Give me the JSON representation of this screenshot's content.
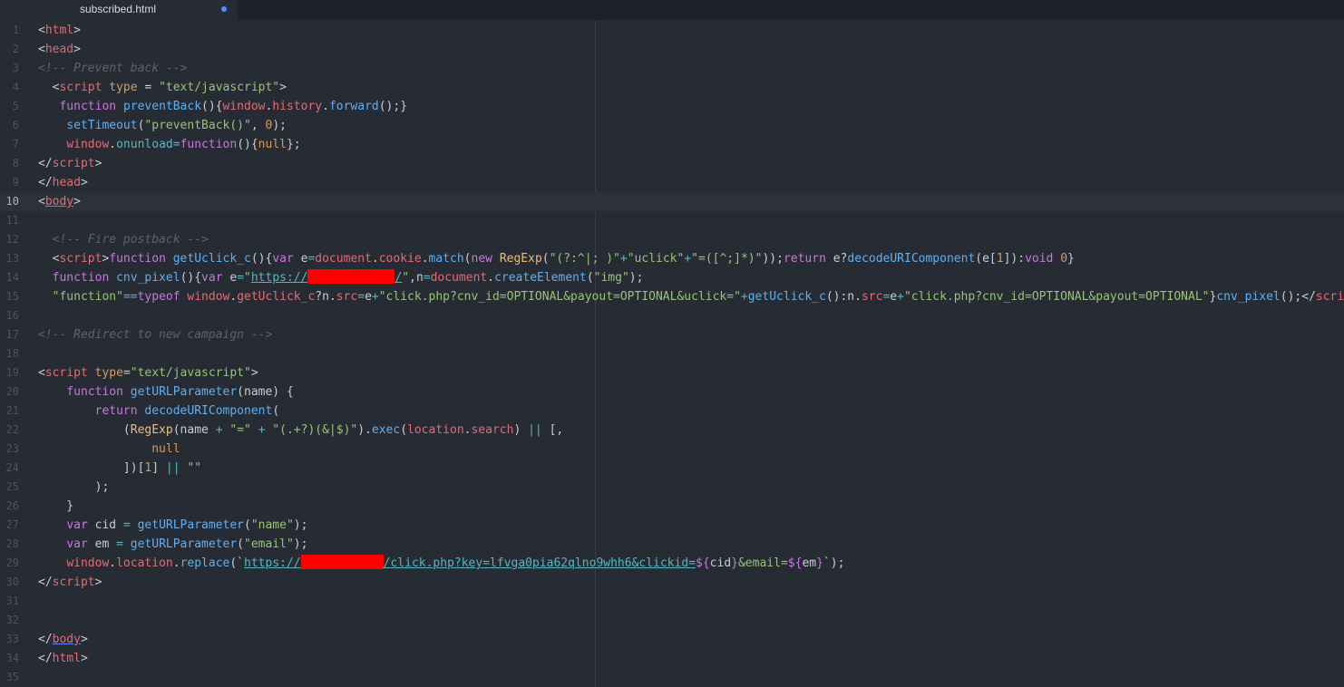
{
  "tab": {
    "title": "subscribed.html"
  },
  "colors": {
    "background": "#272b33",
    "tab_modified_dot": "#528bff",
    "redaction": "#ff0000"
  },
  "lines": [
    {
      "n": "1",
      "tokens": [
        [
          "t-punc",
          "<"
        ],
        [
          "t-tag",
          "html"
        ],
        [
          "t-punc",
          ">"
        ]
      ]
    },
    {
      "n": "2",
      "tokens": [
        [
          "t-punc",
          "<"
        ],
        [
          "t-tag",
          "head"
        ],
        [
          "t-punc",
          ">"
        ]
      ]
    },
    {
      "n": "3",
      "tokens": [
        [
          "t-com",
          "<!-- Prevent back -->"
        ]
      ]
    },
    {
      "n": "4",
      "tokens": [
        [
          "t-plain",
          "  "
        ],
        [
          "t-punc",
          "<"
        ],
        [
          "t-tag",
          "script"
        ],
        [
          "t-plain",
          " "
        ],
        [
          "t-attr",
          "type"
        ],
        [
          "t-plain",
          " = "
        ],
        [
          "t-str",
          "\"text/javascript\""
        ],
        [
          "t-punc",
          ">"
        ]
      ]
    },
    {
      "n": "5",
      "tokens": [
        [
          "t-plain",
          "   "
        ],
        [
          "t-kw",
          "function"
        ],
        [
          "t-plain",
          " "
        ],
        [
          "t-fn",
          "preventBack"
        ],
        [
          "t-plain",
          "(){"
        ],
        [
          "t-var",
          "window"
        ],
        [
          "t-plain",
          "."
        ],
        [
          "t-var",
          "history"
        ],
        [
          "t-plain",
          "."
        ],
        [
          "t-fn",
          "forward"
        ],
        [
          "t-plain",
          "();}"
        ]
      ]
    },
    {
      "n": "6",
      "tokens": [
        [
          "t-plain",
          "    "
        ],
        [
          "t-fn",
          "setTimeout"
        ],
        [
          "t-plain",
          "("
        ],
        [
          "t-str",
          "\"preventBack()\""
        ],
        [
          "t-plain",
          ", "
        ],
        [
          "t-num",
          "0"
        ],
        [
          "t-plain",
          ");"
        ]
      ]
    },
    {
      "n": "7",
      "tokens": [
        [
          "t-plain",
          "    "
        ],
        [
          "t-var",
          "window"
        ],
        [
          "t-plain",
          "."
        ],
        [
          "t-prop",
          "onunload"
        ],
        [
          "t-op",
          "="
        ],
        [
          "t-kw",
          "function"
        ],
        [
          "t-plain",
          "(){"
        ],
        [
          "t-num",
          "null"
        ],
        [
          "t-plain",
          "};"
        ]
      ]
    },
    {
      "n": "8",
      "tokens": [
        [
          "t-punc",
          "</"
        ],
        [
          "t-tag",
          "script"
        ],
        [
          "t-punc",
          ">"
        ]
      ]
    },
    {
      "n": "9",
      "tokens": [
        [
          "t-punc",
          "</"
        ],
        [
          "t-tag",
          "head"
        ],
        [
          "t-punc",
          ">"
        ]
      ]
    },
    {
      "n": "10",
      "active": true,
      "tokens": [
        [
          "t-punc",
          "<"
        ],
        [
          "t-tag under",
          "body"
        ],
        [
          "t-punc",
          ">"
        ]
      ]
    },
    {
      "n": "11",
      "tokens": []
    },
    {
      "n": "12",
      "tokens": [
        [
          "t-plain",
          "  "
        ],
        [
          "t-com",
          "<!-- Fire postback -->"
        ]
      ]
    },
    {
      "n": "13",
      "tokens": [
        [
          "t-plain",
          "  "
        ],
        [
          "t-punc",
          "<"
        ],
        [
          "t-tag",
          "script"
        ],
        [
          "t-punc",
          ">"
        ],
        [
          "t-kw",
          "function"
        ],
        [
          "t-plain",
          " "
        ],
        [
          "t-fn",
          "getUclick_c"
        ],
        [
          "t-plain",
          "(){"
        ],
        [
          "t-kw",
          "var"
        ],
        [
          "t-plain",
          " e"
        ],
        [
          "t-op",
          "="
        ],
        [
          "t-var",
          "document"
        ],
        [
          "t-plain",
          "."
        ],
        [
          "t-var",
          "cookie"
        ],
        [
          "t-plain",
          "."
        ],
        [
          "t-fn",
          "match"
        ],
        [
          "t-plain",
          "("
        ],
        [
          "t-kw",
          "new"
        ],
        [
          "t-plain",
          " "
        ],
        [
          "t-cls",
          "RegExp"
        ],
        [
          "t-plain",
          "("
        ],
        [
          "t-str",
          "\"(?:^|; )\""
        ],
        [
          "t-op",
          "+"
        ],
        [
          "t-str",
          "\"uclick\""
        ],
        [
          "t-op",
          "+"
        ],
        [
          "t-str",
          "\"=([^;]*)\""
        ],
        [
          "t-plain",
          "));"
        ],
        [
          "t-kw",
          "return"
        ],
        [
          "t-plain",
          " e?"
        ],
        [
          "t-fn",
          "decodeURIComponent"
        ],
        [
          "t-plain",
          "(e["
        ],
        [
          "t-num",
          "1"
        ],
        [
          "t-plain",
          "]):"
        ],
        [
          "t-kw",
          "void"
        ],
        [
          "t-plain",
          " "
        ],
        [
          "t-num",
          "0"
        ],
        [
          "t-plain",
          "}"
        ]
      ]
    },
    {
      "n": "14",
      "tokens": [
        [
          "t-plain",
          "  "
        ],
        [
          "t-kw",
          "function"
        ],
        [
          "t-plain",
          " "
        ],
        [
          "t-fn",
          "cnv_pixel"
        ],
        [
          "t-plain",
          "(){"
        ],
        [
          "t-kw",
          "var"
        ],
        [
          "t-plain",
          " e"
        ],
        [
          "t-op",
          "="
        ],
        [
          "t-str",
          "\""
        ],
        [
          "t-url",
          "https://"
        ],
        [
          "redact",
          ""
        ],
        [
          "t-url",
          "/"
        ],
        [
          "t-str",
          "\""
        ],
        [
          "t-plain",
          ",n"
        ],
        [
          "t-op",
          "="
        ],
        [
          "t-var",
          "document"
        ],
        [
          "t-plain",
          "."
        ],
        [
          "t-fn",
          "createElement"
        ],
        [
          "t-plain",
          "("
        ],
        [
          "t-str",
          "\"img\""
        ],
        [
          "t-plain",
          ");"
        ]
      ]
    },
    {
      "n": "15",
      "tokens": [
        [
          "t-plain",
          "  "
        ],
        [
          "t-str",
          "\"function\""
        ],
        [
          "t-op",
          "=="
        ],
        [
          "t-kw",
          "typeof"
        ],
        [
          "t-plain",
          " "
        ],
        [
          "t-var",
          "window"
        ],
        [
          "t-plain",
          "."
        ],
        [
          "t-var",
          "getUclick_c"
        ],
        [
          "t-plain",
          "?n."
        ],
        [
          "t-var",
          "src"
        ],
        [
          "t-op",
          "="
        ],
        [
          "t-plain",
          "e"
        ],
        [
          "t-op",
          "+"
        ],
        [
          "t-str",
          "\"click.php?cnv_id=OPTIONAL&payout=OPTIONAL&uclick=\""
        ],
        [
          "t-op",
          "+"
        ],
        [
          "t-fn",
          "getUclick_c"
        ],
        [
          "t-plain",
          "():n."
        ],
        [
          "t-var",
          "src"
        ],
        [
          "t-op",
          "="
        ],
        [
          "t-plain",
          "e"
        ],
        [
          "t-op",
          "+"
        ],
        [
          "t-str",
          "\"click.php?cnv_id=OPTIONAL&payout=OPTIONAL\""
        ],
        [
          "t-plain",
          "}"
        ],
        [
          "t-fn",
          "cnv_pixel"
        ],
        [
          "t-plain",
          "();"
        ],
        [
          "t-punc",
          "</"
        ],
        [
          "t-tag",
          "script"
        ],
        [
          "t-punc",
          ">"
        ]
      ]
    },
    {
      "n": "16",
      "tokens": []
    },
    {
      "n": "17",
      "tokens": [
        [
          "t-com",
          "<!-- Redirect to new campaign -->"
        ]
      ]
    },
    {
      "n": "18",
      "tokens": []
    },
    {
      "n": "19",
      "tokens": [
        [
          "t-punc",
          "<"
        ],
        [
          "t-tag",
          "script"
        ],
        [
          "t-plain",
          " "
        ],
        [
          "t-attr",
          "type"
        ],
        [
          "t-plain",
          "="
        ],
        [
          "t-str",
          "\"text/javascript\""
        ],
        [
          "t-punc",
          ">"
        ]
      ]
    },
    {
      "n": "20",
      "tokens": [
        [
          "t-plain",
          "    "
        ],
        [
          "t-kw",
          "function"
        ],
        [
          "t-plain",
          " "
        ],
        [
          "t-fn",
          "getURLParameter"
        ],
        [
          "t-plain",
          "(name) {"
        ]
      ]
    },
    {
      "n": "21",
      "tokens": [
        [
          "t-plain",
          "        "
        ],
        [
          "t-kw",
          "return"
        ],
        [
          "t-plain",
          " "
        ],
        [
          "t-fn",
          "decodeURIComponent"
        ],
        [
          "t-plain",
          "("
        ]
      ]
    },
    {
      "n": "22",
      "tokens": [
        [
          "t-plain",
          "            ("
        ],
        [
          "t-cls",
          "RegExp"
        ],
        [
          "t-plain",
          "(name "
        ],
        [
          "t-op",
          "+"
        ],
        [
          "t-plain",
          " "
        ],
        [
          "t-str",
          "\"=\""
        ],
        [
          "t-plain",
          " "
        ],
        [
          "t-op",
          "+"
        ],
        [
          "t-plain",
          " "
        ],
        [
          "t-str",
          "\"(.+?)(&|$)\""
        ],
        [
          "t-plain",
          ")."
        ],
        [
          "t-fn",
          "exec"
        ],
        [
          "t-plain",
          "("
        ],
        [
          "t-var",
          "location"
        ],
        [
          "t-plain",
          "."
        ],
        [
          "t-var",
          "search"
        ],
        [
          "t-plain",
          ") "
        ],
        [
          "t-op",
          "||"
        ],
        [
          "t-plain",
          " [,"
        ]
      ]
    },
    {
      "n": "23",
      "tokens": [
        [
          "t-plain",
          "                "
        ],
        [
          "t-num",
          "null"
        ]
      ]
    },
    {
      "n": "24",
      "tokens": [
        [
          "t-plain",
          "            ])["
        ],
        [
          "t-num",
          "1"
        ],
        [
          "t-plain",
          "] "
        ],
        [
          "t-op",
          "||"
        ],
        [
          "t-plain",
          " "
        ],
        [
          "t-str",
          "\"\""
        ]
      ]
    },
    {
      "n": "25",
      "tokens": [
        [
          "t-plain",
          "        );"
        ]
      ]
    },
    {
      "n": "26",
      "tokens": [
        [
          "t-plain",
          "    }"
        ]
      ]
    },
    {
      "n": "27",
      "tokens": [
        [
          "t-plain",
          "    "
        ],
        [
          "t-kw",
          "var"
        ],
        [
          "t-plain",
          " cid "
        ],
        [
          "t-op",
          "="
        ],
        [
          "t-plain",
          " "
        ],
        [
          "t-fn",
          "getURLParameter"
        ],
        [
          "t-plain",
          "("
        ],
        [
          "t-str",
          "\"name\""
        ],
        [
          "t-plain",
          ");"
        ]
      ]
    },
    {
      "n": "28",
      "tokens": [
        [
          "t-plain",
          "    "
        ],
        [
          "t-kw",
          "var"
        ],
        [
          "t-plain",
          " em "
        ],
        [
          "t-op",
          "="
        ],
        [
          "t-plain",
          " "
        ],
        [
          "t-fn",
          "getURLParameter"
        ],
        [
          "t-plain",
          "("
        ],
        [
          "t-str",
          "\"email\""
        ],
        [
          "t-plain",
          ");"
        ]
      ]
    },
    {
      "n": "29",
      "tokens": [
        [
          "t-plain",
          "    "
        ],
        [
          "t-var",
          "window"
        ],
        [
          "t-plain",
          "."
        ],
        [
          "t-var",
          "location"
        ],
        [
          "t-plain",
          "."
        ],
        [
          "t-fn",
          "replace"
        ],
        [
          "t-plain",
          "(`"
        ],
        [
          "t-url",
          "https://"
        ],
        [
          "redact narrow",
          ""
        ],
        [
          "t-url",
          "/click.php?key=lfvga0pia62qlno9whh6&clickid="
        ],
        [
          "t-kw",
          "${"
        ],
        [
          "t-plain",
          "cid"
        ],
        [
          "t-kw",
          "}"
        ],
        [
          "t-str",
          "&email="
        ],
        [
          "t-kw",
          "${"
        ],
        [
          "t-plain",
          "em"
        ],
        [
          "t-kw",
          "}"
        ],
        [
          "t-plain",
          "`);"
        ]
      ]
    },
    {
      "n": "30",
      "tokens": [
        [
          "t-punc",
          "</"
        ],
        [
          "t-tag",
          "script"
        ],
        [
          "t-punc",
          ">"
        ]
      ]
    },
    {
      "n": "31",
      "tokens": []
    },
    {
      "n": "32",
      "tokens": []
    },
    {
      "n": "33",
      "tokens": [
        [
          "t-punc",
          "</"
        ],
        [
          "t-tag under",
          "body"
        ],
        [
          "t-punc",
          ">"
        ]
      ]
    },
    {
      "n": "34",
      "tokens": [
        [
          "t-punc",
          "</"
        ],
        [
          "t-tag",
          "html"
        ],
        [
          "t-punc",
          ">"
        ]
      ]
    },
    {
      "n": "35",
      "tokens": []
    }
  ]
}
